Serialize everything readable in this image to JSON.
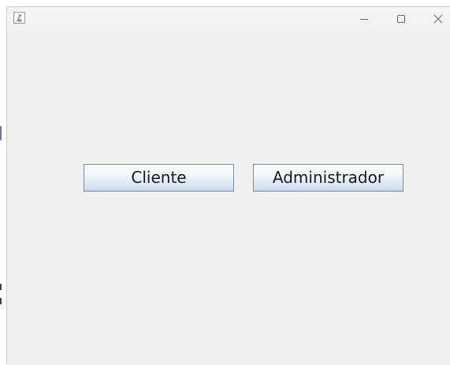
{
  "window": {
    "title": "",
    "controls": {
      "minimize": "minimize-icon",
      "maximize": "maximize-icon",
      "close": "close-icon"
    }
  },
  "main": {
    "buttons": {
      "cliente": "Cliente",
      "administrador": "Administrador"
    }
  },
  "colors": {
    "background": "#f0f0f0",
    "button_border": "#7a8a99",
    "button_gradient_top": "#ffffff",
    "button_gradient_bottom": "#c9daec"
  }
}
